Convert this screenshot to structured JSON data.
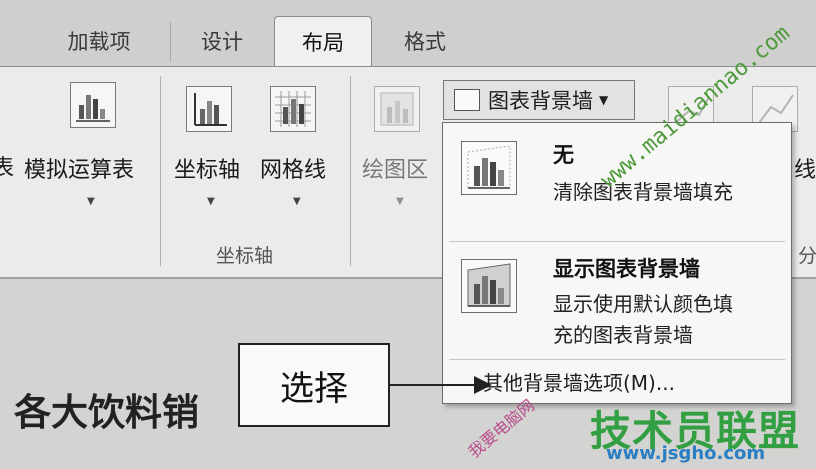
{
  "tabs": {
    "addins": "加载项",
    "design": "设计",
    "layout": "布局",
    "format": "格式"
  },
  "ribbon": {
    "partial_left": "表",
    "data_table": "模拟运算表",
    "axes": "坐标轴",
    "gridlines": "网格线",
    "plot_area": "绘图区",
    "axes_group": "坐标轴",
    "chart_wall": "图表背景墙",
    "partial_right": "线",
    "partial_right2": "分"
  },
  "menu": {
    "none_title": "无",
    "none_desc": "清除图表背景墙填充",
    "show_title": "显示图表背景墙",
    "show_desc_1": "显示使用默认颜色填",
    "show_desc_2": "充的图表背景墙",
    "more": "其他背景墙选项(M)..."
  },
  "document": {
    "title_partial": "各大饮料销"
  },
  "callout": {
    "text": "选择"
  },
  "watermarks": {
    "url": "www.maidiannao.com",
    "cn_text": "我要电脑网",
    "logo_cn": "技术员联盟",
    "logo_url": "www.jsgho.com"
  },
  "colors": {
    "watermark_green": "#4e9a3c",
    "watermark_pink": "#b84f8c",
    "logo_green": "#32a042",
    "logo_blue": "#2a7fc4"
  }
}
